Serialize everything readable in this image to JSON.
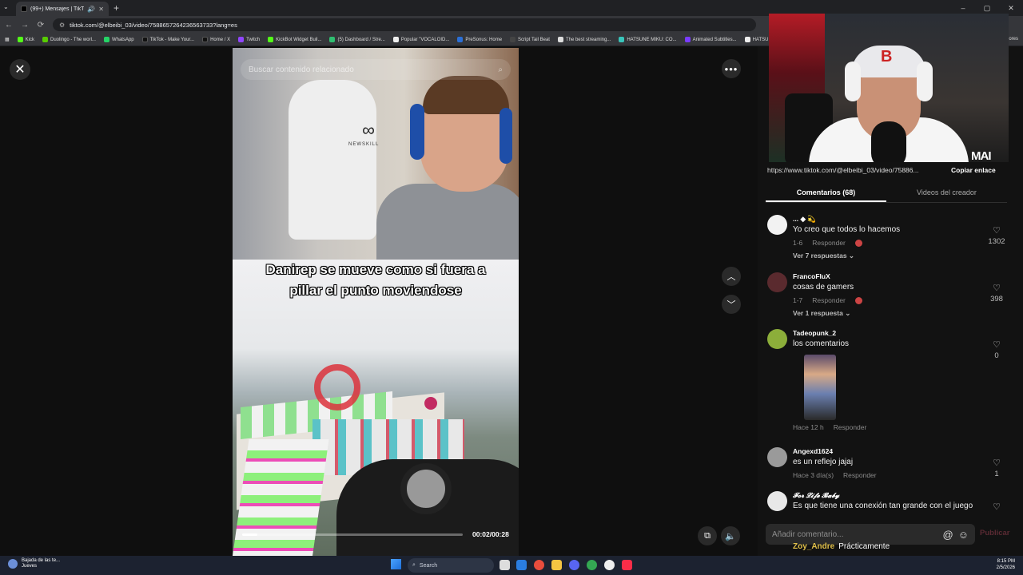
{
  "browser": {
    "tab_title": "(99+) Mensajes | TikTok",
    "new_tab": "+",
    "url": "tiktok.com/@elbeibi_03/video/7588657264236563733?lang=es",
    "window_controls": [
      "–",
      "▢",
      "✕"
    ]
  },
  "bookmarks": [
    {
      "label": "Kick",
      "color": "#53fc18"
    },
    {
      "label": "Duolingo - The worl...",
      "color": "#58cc02"
    },
    {
      "label": "WhatsApp",
      "color": "#25d366"
    },
    {
      "label": "TikTok - Make Your...",
      "color": "#111111"
    },
    {
      "label": "Home / X",
      "color": "#111111"
    },
    {
      "label": "Twitch",
      "color": "#9146ff"
    },
    {
      "label": "KickBot Widget Buil...",
      "color": "#53fc18"
    },
    {
      "label": "(5) Dashboard / Stre...",
      "color": "#2fbf71"
    },
    {
      "label": "Popular \"VOCALOID...",
      "color": "#eeeeee"
    },
    {
      "label": "PreSonus: Home",
      "color": "#2b6fd6"
    },
    {
      "label": "Script Tail Beat",
      "color": "#444444"
    },
    {
      "label": "The best streaming...",
      "color": "#dddddd"
    },
    {
      "label": "HATSUNE MIKU: CO...",
      "color": "#39c5bb"
    },
    {
      "label": "Animated Subtitles...",
      "color": "#7a3cff"
    },
    {
      "label": "HATSUNE M",
      "color": "#eeeeee"
    }
  ],
  "bookmarks_overflow": "ores",
  "video": {
    "search_placeholder": "Buscar contenido relacionado",
    "caption": "Danirep se mueve como si fuera a pillar el punto moviendose",
    "chair_brand": "NEWSKILL",
    "time": "00:02/00:28",
    "progress": 0.07
  },
  "share": {
    "url": "https://www.tiktok.com/@elbeibi_03/video/75886...",
    "copy_label": "Copiar enlace"
  },
  "tabs": {
    "comments": "Comentarios (68)",
    "creator_videos": "Videos del creador"
  },
  "comments": [
    {
      "user": "... ◆ 💫",
      "text": "Yo creo que todos lo hacemos",
      "date": "1-6",
      "reply": "Responder",
      "likes": "1302",
      "replies": "Ver 7 respuestas ⌄",
      "avatar_color": "#f2f2f2"
    },
    {
      "user": "FrancoFluX",
      "text": "cosas de gamers",
      "date": "1-7",
      "reply": "Responder",
      "likes": "398",
      "replies": "Ver 1 respuesta ⌄",
      "avatar_color": "#5a2a2e"
    },
    {
      "user": "Tadeopunk_2",
      "text": "los comentarios",
      "date": "Hace 12 h",
      "reply": "Responder",
      "likes": "0",
      "replies": "",
      "avatar_color": "#8cae3a"
    },
    {
      "user": "Angexd1624",
      "text": "es un reflejo jajaj",
      "date": "Hace 3 día(s)",
      "reply": "Responder",
      "likes": "1",
      "replies": "",
      "avatar_color": "#9a9a9a"
    },
    {
      "user": "𝓕𝓸𝓻 𝓛𝓲𝓯𝓮 𝓑𝓪𝓫𝔂",
      "text": "Es que tiene una conexión tan grande con el juego",
      "date": "",
      "reply": "",
      "likes": "",
      "replies": "",
      "avatar_color": "#e8e8e8"
    }
  ],
  "comment_input": {
    "placeholder": "Añadir comentario...",
    "at_icon": "@",
    "emoji_icon": "☺",
    "publish": "Publicar"
  },
  "chat_overlay": {
    "user": "Zoy_Andre",
    "message": "Prácticamente"
  },
  "webcam": {
    "logo": "MAI",
    "cap_logo": "B"
  },
  "taskbar": {
    "weather_title": "Bajada de las te...",
    "weather_sub": "Jueves",
    "search": "Search",
    "time": "8:15 PM",
    "date": "2/5/2026"
  }
}
